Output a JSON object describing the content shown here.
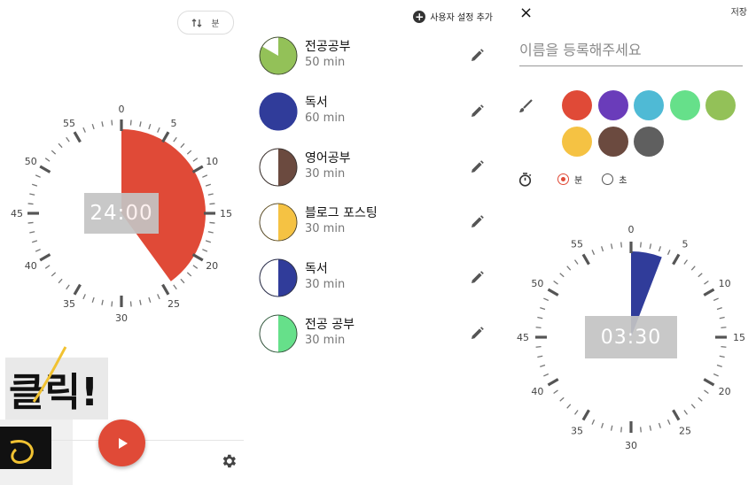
{
  "left": {
    "sort_label": "분",
    "timer_display": "24:00",
    "elapsed_minutes": 24,
    "accent": "#e04a37",
    "click_label": "클릭!",
    "dial_labels": [
      "0",
      "5",
      "10",
      "15",
      "20",
      "25",
      "30",
      "35",
      "40",
      "45",
      "50",
      "55"
    ]
  },
  "list": {
    "add_label": "사용자 설정 추가",
    "items": [
      {
        "name": "전공공부",
        "duration": "50 min",
        "color": "#93c158",
        "minutes": 50
      },
      {
        "name": "독서",
        "duration": "60 min",
        "color": "#303c9a",
        "minutes": 60
      },
      {
        "name": "영어공부",
        "duration": "30 min",
        "color": "#6b4a3f",
        "minutes": 30
      },
      {
        "name": "블로그 포스팅",
        "duration": "30 min",
        "color": "#f5c243",
        "minutes": 30
      },
      {
        "name": "독서",
        "duration": "30 min",
        "color": "#303c9a",
        "minutes": 30
      },
      {
        "name": "전공 공부",
        "duration": "30 min",
        "color": "#66e08a",
        "minutes": 30
      }
    ]
  },
  "editor": {
    "close_icon": "×",
    "save_label": "저장",
    "name_placeholder": "이름을 등록해주세요",
    "colors": [
      "#e04a37",
      "#6a3cba",
      "#4fbad5",
      "#66e08a",
      "#93c158",
      "#f5c243",
      "#6b4a3f",
      "#5f5f5f"
    ],
    "unit_minutes_label": "분",
    "unit_seconds_label": "초",
    "unit_selected": "분",
    "timer_display": "03:30",
    "timer_minutes": 3.5,
    "timer_color": "#303c9a",
    "dial_labels": [
      "0",
      "5",
      "10",
      "15",
      "20",
      "25",
      "30",
      "35",
      "40",
      "45",
      "50",
      "55"
    ]
  }
}
